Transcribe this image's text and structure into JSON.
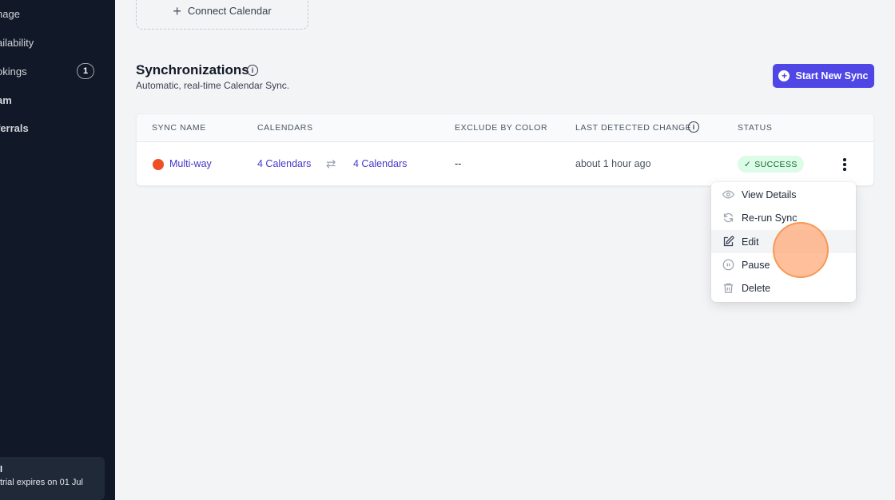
{
  "sidebar": {
    "items": [
      {
        "label": "nage"
      },
      {
        "label": "ailability"
      },
      {
        "label": "okings",
        "badge": "1"
      },
      {
        "label": "am"
      },
      {
        "label": "ferrals"
      }
    ],
    "trial": {
      "title": "l",
      "text": "trial expires on 01 Jul"
    }
  },
  "connect_calendar": {
    "label": "Connect Calendar"
  },
  "section": {
    "title": "Synchronizations",
    "subtitle": "Automatic, real-time Calendar Sync.",
    "start_button": "Start New Sync"
  },
  "table": {
    "headers": {
      "sync_name": "SYNC NAME",
      "calendars": "CALENDARS",
      "exclude_by_color": "EXCLUDE BY COLOR",
      "last_detected_change": "LAST DETECTED CHANGE",
      "status": "STATUS"
    },
    "rows": [
      {
        "dot_color": "#f04e23",
        "name": "Multi-way",
        "calendars_from": "4 Calendars",
        "calendars_to": "4 Calendars",
        "exclude": "--",
        "last_change": "about 1 hour ago",
        "status": "SUCCESS"
      }
    ]
  },
  "menu": {
    "items": [
      {
        "label": "View Details",
        "icon": "eye-icon"
      },
      {
        "label": "Re-run Sync",
        "icon": "refresh-icon"
      },
      {
        "label": "Edit",
        "icon": "edit-icon"
      },
      {
        "label": "Pause",
        "icon": "pause-icon"
      },
      {
        "label": "Delete",
        "icon": "trash-icon"
      }
    ]
  },
  "colors": {
    "sidebar_bg": "#111827",
    "accent": "#4f46e5",
    "link": "#4338ca",
    "success_bg": "#dcfce7",
    "success_text": "#166534"
  }
}
